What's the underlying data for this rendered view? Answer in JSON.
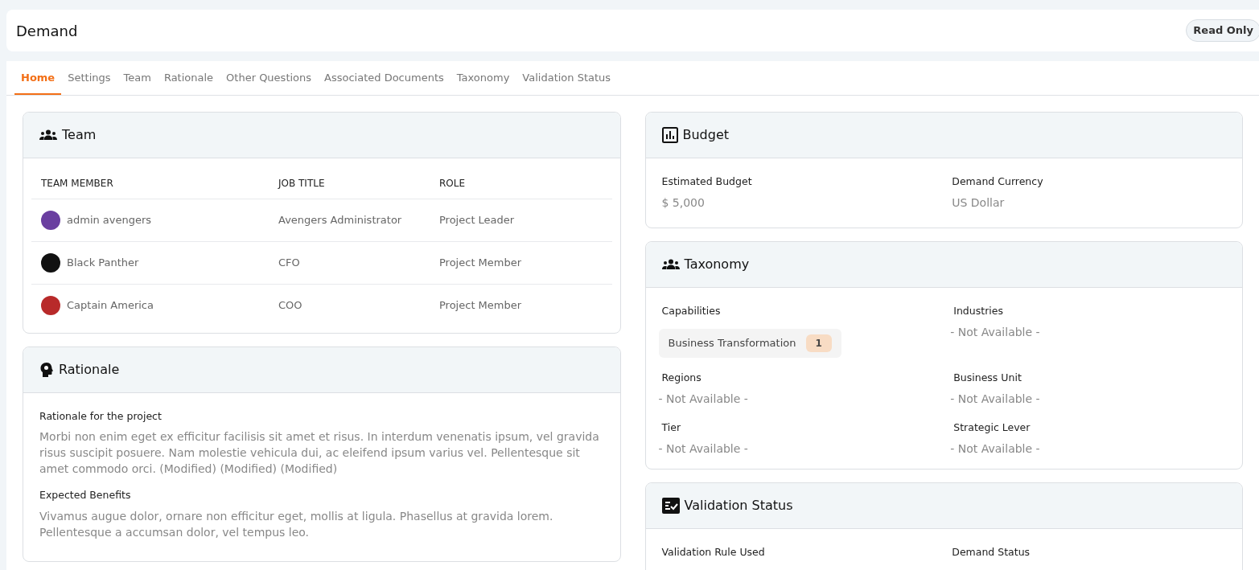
{
  "header": {
    "title": "Demand",
    "badge": "Read Only"
  },
  "tabs": [
    {
      "label": "Home",
      "selected": true
    },
    {
      "label": "Settings",
      "selected": false
    },
    {
      "label": "Team",
      "selected": false
    },
    {
      "label": "Rationale",
      "selected": false
    },
    {
      "label": "Other Questions",
      "selected": false
    },
    {
      "label": "Associated Documents",
      "selected": false
    },
    {
      "label": "Taxonomy",
      "selected": false
    },
    {
      "label": "Validation Status",
      "selected": false
    }
  ],
  "team": {
    "title": "Team",
    "columns": [
      "TEAM MEMBER",
      "JOB TITLE",
      "ROLE"
    ],
    "rows": [
      {
        "member": "admin avengers",
        "job_title": "Avengers Administrator",
        "role": "Project Leader",
        "color": "#6a3fa0"
      },
      {
        "member": "Black Panther",
        "job_title": "CFO",
        "role": "Project Member",
        "color": "#111111"
      },
      {
        "member": "Captain America",
        "job_title": "COO",
        "role": "Project Member",
        "color": "#b82a2a"
      }
    ]
  },
  "rationale": {
    "title": "Rationale",
    "sections": [
      {
        "label": "Rationale for the project",
        "text": "Morbi non enim eget ex efficitur facilisis sit amet et risus. In interdum venenatis ipsum, vel gravida risus suscipit posuere. Nam molestie vehicula dui, ac eleifend ipsum varius vel. Pellentesque sit amet commodo orci. (Modified) (Modified) (Modified)"
      },
      {
        "label": "Expected Benefits",
        "text": "Vivamus augue dolor, ornare non efficitur eget, mollis at ligula. Phasellus at gravida lorem. Pellentesque a accumsan dolor, vel tempus leo."
      }
    ]
  },
  "budget": {
    "title": "Budget",
    "fields": [
      {
        "label": "Estimated Budget",
        "value": "$ 5,000"
      },
      {
        "label": "Demand Currency",
        "value": "US Dollar"
      }
    ]
  },
  "taxonomy": {
    "title": "Taxonomy",
    "fields": [
      {
        "label": "Capabilities",
        "kind": "tags",
        "tags": [
          {
            "label": "Business Transformation",
            "count": "1"
          }
        ]
      },
      {
        "label": "Industries",
        "kind": "text",
        "value": "- Not Available -"
      },
      {
        "label": "Regions",
        "kind": "text",
        "value": "- Not Available -"
      },
      {
        "label": "Business Unit",
        "kind": "text",
        "value": "- Not Available -"
      },
      {
        "label": "Tier",
        "kind": "text",
        "value": "- Not Available -"
      },
      {
        "label": "Strategic Lever",
        "kind": "text",
        "value": "- Not Available -"
      }
    ]
  },
  "validation": {
    "title": "Validation Status",
    "fields": [
      {
        "label": "Validation Rule Used"
      },
      {
        "label": "Demand Status"
      }
    ]
  }
}
